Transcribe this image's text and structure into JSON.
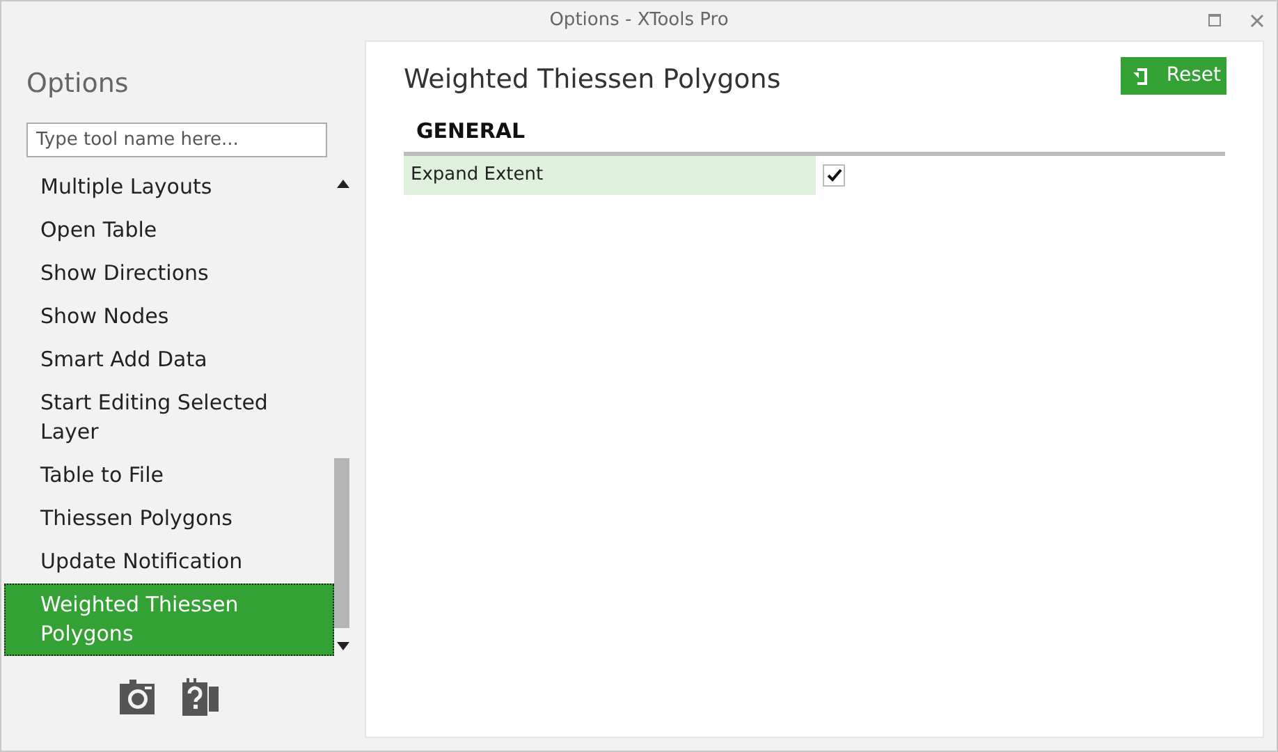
{
  "window": {
    "title": "Options - XTools Pro"
  },
  "sidebar": {
    "title": "Options",
    "search": {
      "placeholder": "Type tool name here..."
    },
    "items": [
      {
        "label": "Multiple Layouts",
        "selected": false
      },
      {
        "label": "Open Table",
        "selected": false
      },
      {
        "label": "Show Directions",
        "selected": false
      },
      {
        "label": "Show Nodes",
        "selected": false
      },
      {
        "label": "Smart Add Data",
        "selected": false
      },
      {
        "label": "Start Editing Selected Layer",
        "selected": false
      },
      {
        "label": "Table to File",
        "selected": false
      },
      {
        "label": "Thiessen Polygons",
        "selected": false
      },
      {
        "label": "Update Notification",
        "selected": false
      },
      {
        "label": "Weighted Thiessen Polygons",
        "selected": true
      }
    ]
  },
  "panel": {
    "title": "Weighted Thiessen Polygons",
    "reset_button": "Reset",
    "sections": [
      {
        "title": "GENERAL",
        "options": [
          {
            "label": "Expand Extent",
            "checked": true
          }
        ]
      }
    ]
  }
}
